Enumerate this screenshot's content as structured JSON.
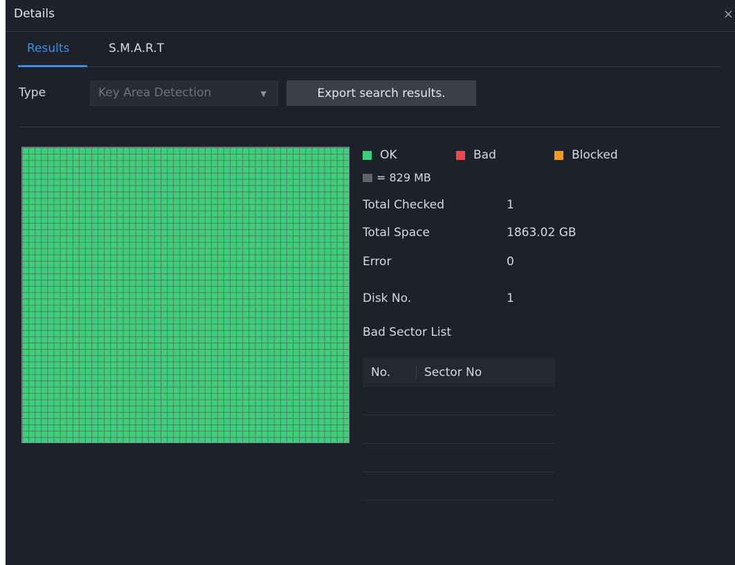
{
  "window": {
    "title": "Details",
    "close_glyph": "×"
  },
  "tabs": [
    {
      "label": "Results",
      "active": true
    },
    {
      "label": "S.M.A.R.T",
      "active": false
    }
  ],
  "filter": {
    "type_label": "Type",
    "type_value": "Key Area Detection",
    "dropdown_glyph": "▼",
    "export_label": "Export search results."
  },
  "legend": {
    "ok": {
      "label": "OK",
      "color": "#3cd07a"
    },
    "bad": {
      "label": "Bad",
      "color": "#f0474f"
    },
    "blocked": {
      "label": "Blocked",
      "color": "#f19a1a"
    },
    "unit": {
      "label": "= 829 MB",
      "color": "#5f636b"
    }
  },
  "info": {
    "total_checked_label": "Total Checked",
    "total_checked_value": "1",
    "total_space_label": "Total Space",
    "total_space_value": "1863.02 GB",
    "error_label": "Error",
    "error_value": "0",
    "disk_no_label": "Disk No.",
    "disk_no_value": "1"
  },
  "bad_sector": {
    "title": "Bad Sector List",
    "columns": [
      "No.",
      "Sector No"
    ],
    "rows": []
  },
  "colors": {
    "accent": "#3d8fe6",
    "background": "#1d212a",
    "block_ok": "#3cd07a"
  }
}
